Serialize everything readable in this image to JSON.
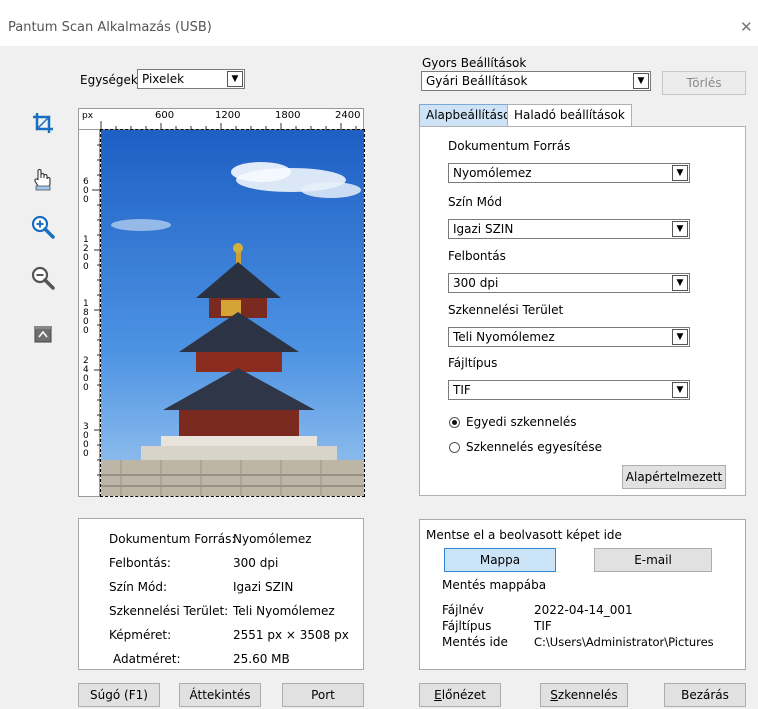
{
  "window": {
    "title": "Pantum Scan Alkalmazás (USB)",
    "close_glyph": "✕"
  },
  "units": {
    "label": "Egységek",
    "value": "Pixelek"
  },
  "ruler": {
    "unit": "px",
    "top_ticks": [
      "600",
      "1200",
      "1800",
      "2400"
    ],
    "left_ticks": [
      "600",
      "1200",
      "1800",
      "2400",
      "3000"
    ]
  },
  "tools": [
    "crop-icon",
    "hand-pan-icon",
    "zoom-in-icon",
    "zoom-out-icon",
    "delete-icon"
  ],
  "quick_settings": {
    "label": "Gyors Beállítások",
    "value": "Gyári Beállítások",
    "delete_label": "Törlés"
  },
  "tabs": [
    {
      "label": "Alapbeállítások",
      "active": true
    },
    {
      "label": "Haladó beállítások",
      "active": false
    }
  ],
  "basic": {
    "source_label": "Dokumentum Forrás",
    "source_value": "Nyomólemez",
    "color_label": "Szín Mód",
    "color_value": "Igazi SZIN",
    "resolution_label": "Felbontás",
    "resolution_value": "300 dpi",
    "area_label": "Szkennelési Terület",
    "area_value": "Teli Nyomólemez",
    "filetype_label": "Fájltípus",
    "filetype_value": "TIF",
    "radio_single": "Egyedi szkennelés",
    "radio_merge": "Szkennelés egyesítése",
    "default_button": "Alapértelmezett"
  },
  "summary": [
    {
      "key": "Dokumentum Forrás:",
      "value": "Nyomólemez"
    },
    {
      "key": "Felbontás:",
      "value": "300 dpi"
    },
    {
      "key": "Szín Mód:",
      "value": "Igazi SZIN"
    },
    {
      "key": "Szkennelési Terület:",
      "value": "Teli Nyomólemez"
    },
    {
      "key": "Képméret:",
      "value": "2551 px × 3508 px"
    },
    {
      "key": "Adatméret:",
      "value": "25.60 MB"
    }
  ],
  "save": {
    "heading": "Mentse el a beolvasott képet ide",
    "folder_button": "Mappa",
    "email_button": "E-mail",
    "save_to_folder": "Mentés mappába",
    "filename_label": "Fájlnév",
    "filename_value": "2022-04-14_001",
    "filetype_label": "Fájltípus",
    "filetype_value": "TIF",
    "savepath_label": "Mentés ide",
    "savepath_value": "C:\\Users\\Administrator\\Pictures"
  },
  "bottom_buttons": {
    "help": "Súgó (F1)",
    "overview": "Áttekintés",
    "port": "Port",
    "preview_first": "E",
    "preview_rest": "lőnézet",
    "scan_first": "S",
    "scan_rest": "zkennelés",
    "close": "Bezárás"
  },
  "colors": {
    "accent": "#2f86d6",
    "tab_active": "#cfe3f6",
    "tool_blue": "#1a6fc0"
  }
}
